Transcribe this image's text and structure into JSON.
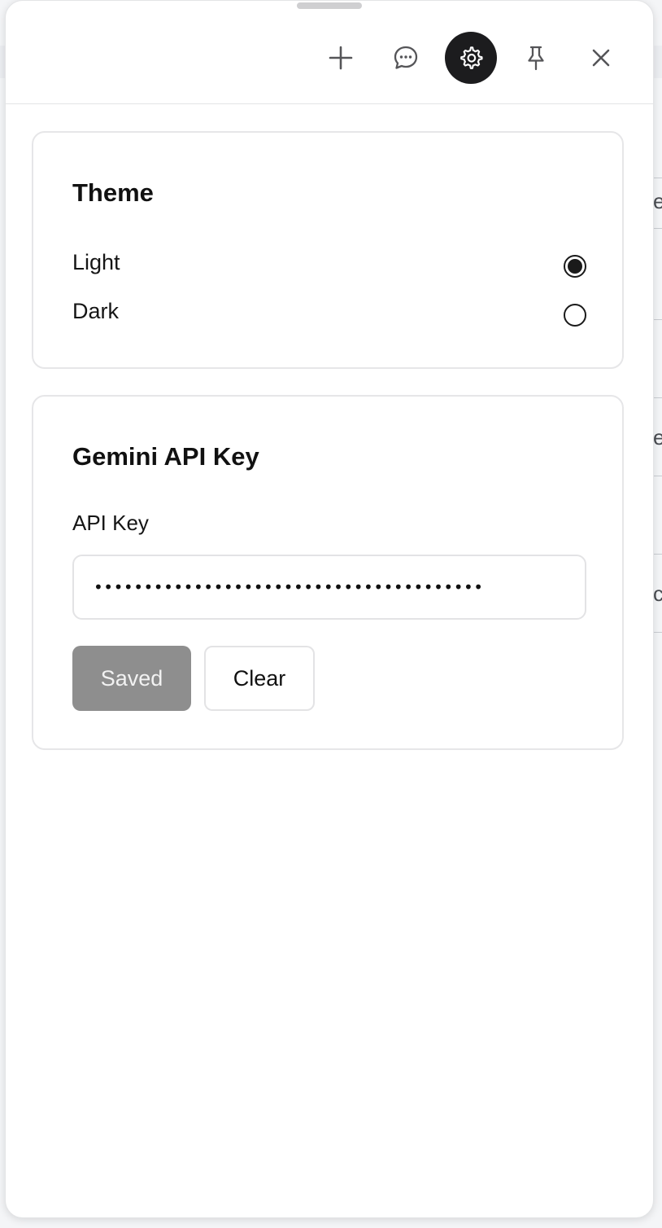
{
  "toolbar": {
    "buttons": [
      {
        "icon": "plus-icon",
        "name": "new"
      },
      {
        "icon": "chat-bubble-icon",
        "name": "chat"
      },
      {
        "icon": "gear-icon",
        "name": "settings",
        "active": true
      },
      {
        "icon": "pin-icon",
        "name": "pin"
      },
      {
        "icon": "close-icon",
        "name": "close"
      }
    ]
  },
  "theme": {
    "title": "Theme",
    "options": [
      {
        "label": "Light",
        "selected": true
      },
      {
        "label": "Dark",
        "selected": false
      }
    ]
  },
  "api_key": {
    "title": "Gemini API Key",
    "field_label": "API Key",
    "value_masked": "•••••••••••••••••••••••••••••••••••••••",
    "save_label": "Saved",
    "clear_label": "Clear"
  },
  "colors": {
    "active_button_bg": "#1c1c1e",
    "saved_button_bg": "#8e8e8e"
  }
}
